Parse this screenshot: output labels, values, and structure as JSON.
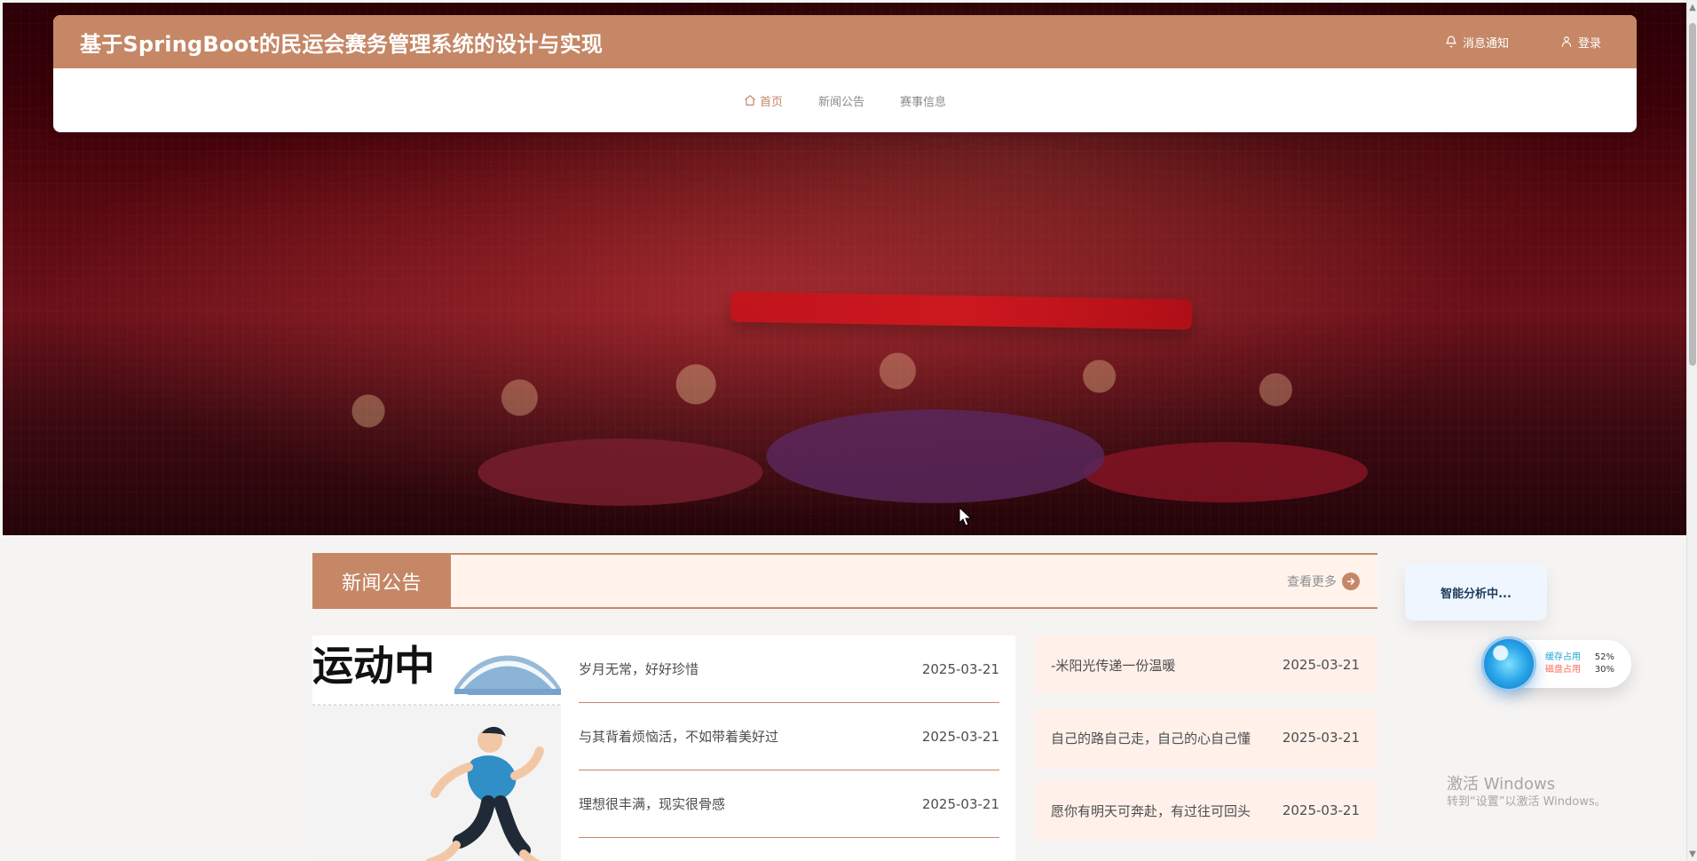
{
  "header": {
    "site_title": "基于SpringBoot的民运会赛务管理系统的设计与实现",
    "actions": [
      {
        "label": "消息通知",
        "icon": "bell-icon"
      },
      {
        "label": "登录",
        "icon": "user-icon"
      }
    ],
    "nav": [
      {
        "label": "首页",
        "icon": "home-icon",
        "active": true
      },
      {
        "label": "新闻公告",
        "active": false
      },
      {
        "label": "赛事信息",
        "active": false
      }
    ],
    "colors": {
      "primary": "#c58766",
      "white": "#ffffff"
    }
  },
  "news_section": {
    "title": "新闻公告",
    "more_label": "查看更多",
    "list_left": [
      {
        "title": "岁月无常，好好珍惜",
        "date": "2025-03-21"
      },
      {
        "title": "与其背着烦恼活，不如带着美好过",
        "date": "2025-03-21"
      },
      {
        "title": "理想很丰满，现实很骨感",
        "date": "2025-03-21"
      }
    ],
    "list_right": [
      {
        "title": "-米阳光传递一份温暖",
        "date": "2025-03-21"
      },
      {
        "title": "自己的路自己走，自己的心自己懂",
        "date": "2025-03-21"
      },
      {
        "title": "愿你有明天可奔赴，有过往可回头",
        "date": "2025-03-21"
      }
    ],
    "image_text": "运动中"
  },
  "widgets": {
    "smart_analysis": "智能分析中...",
    "stats": [
      {
        "label": "缓存占用",
        "value": "52%"
      },
      {
        "label": "磁盘占用",
        "value": "30%"
      }
    ]
  },
  "watermark": {
    "line1": "激活 Windows",
    "line2": "转到“设置”以激活 Windows。"
  }
}
